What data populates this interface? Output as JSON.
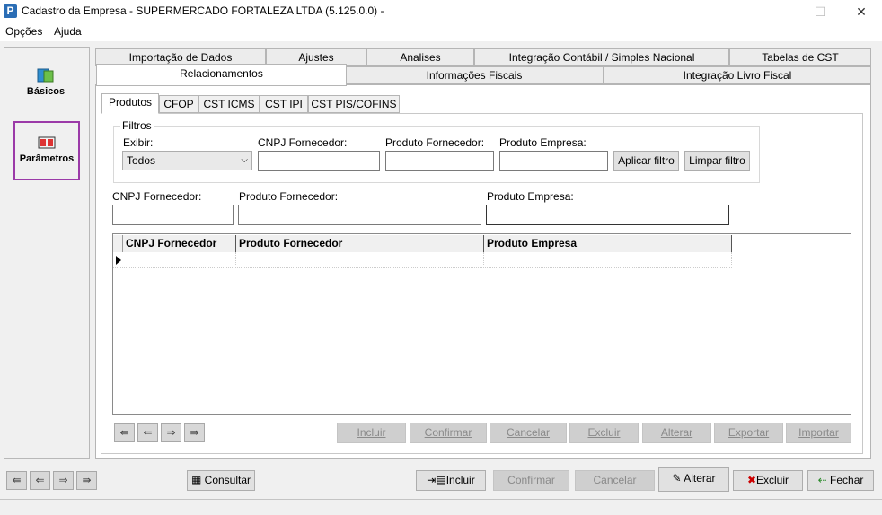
{
  "window": {
    "title": "Cadastro da Empresa - SUPERMERCADO FORTALEZA LTDA (5.125.0.0) -",
    "app_icon": "P",
    "minimize": "—",
    "maximize": "☐",
    "close": "✕"
  },
  "menu": [
    "Opções",
    "Ajuda"
  ],
  "sidebar": {
    "items": [
      {
        "label": "Básicos",
        "icon": "basics-icon"
      },
      {
        "label": "Parâmetros",
        "icon": "parameters-icon"
      }
    ]
  },
  "tabs_row1": [
    "Importação de Dados",
    "Ajustes",
    "Analises",
    "Integração Contábil / Simples Nacional",
    "Tabelas de CST"
  ],
  "tabs_row2": [
    "Relacionamentos",
    "Informações Fiscais",
    "Integração Livro Fiscal"
  ],
  "subtabs": [
    "Produtos",
    "CFOP",
    "CST ICMS",
    "CST IPI",
    "CST PIS/COFINS"
  ],
  "filters": {
    "group_label": "Filtros",
    "exibir_label": "Exibir:",
    "exibir_value": "Todos",
    "cnpj_label": "CNPJ Fornecedor:",
    "produto_fornecedor_label": "Produto Fornecedor:",
    "produto_empresa_label": "Produto Empresa:",
    "apply_button": "Aplicar filtro",
    "clear_button": "Limpar filtro"
  },
  "fields": {
    "cnpj_label": "CNPJ Fornecedor:",
    "produto_fornecedor_label": "Produto Fornecedor:",
    "produto_empresa_label": "Produto Empresa:"
  },
  "grid": {
    "columns": [
      "CNPJ Fornecedor",
      "Produto Fornecedor",
      "Produto Empresa"
    ]
  },
  "grid_buttons": [
    "Incluir",
    "Confirmar",
    "Cancelar",
    "Excluir",
    "Alterar",
    "Exportar",
    "Importar"
  ],
  "bottom": {
    "consultar": "Consultar",
    "incluir": "Incluir",
    "confirmar": "Confirmar",
    "cancelar": "Cancelar",
    "alterar": "Alterar",
    "excluir": "Excluir",
    "fechar": "Fechar"
  },
  "accent_color": "#9b3aa8"
}
